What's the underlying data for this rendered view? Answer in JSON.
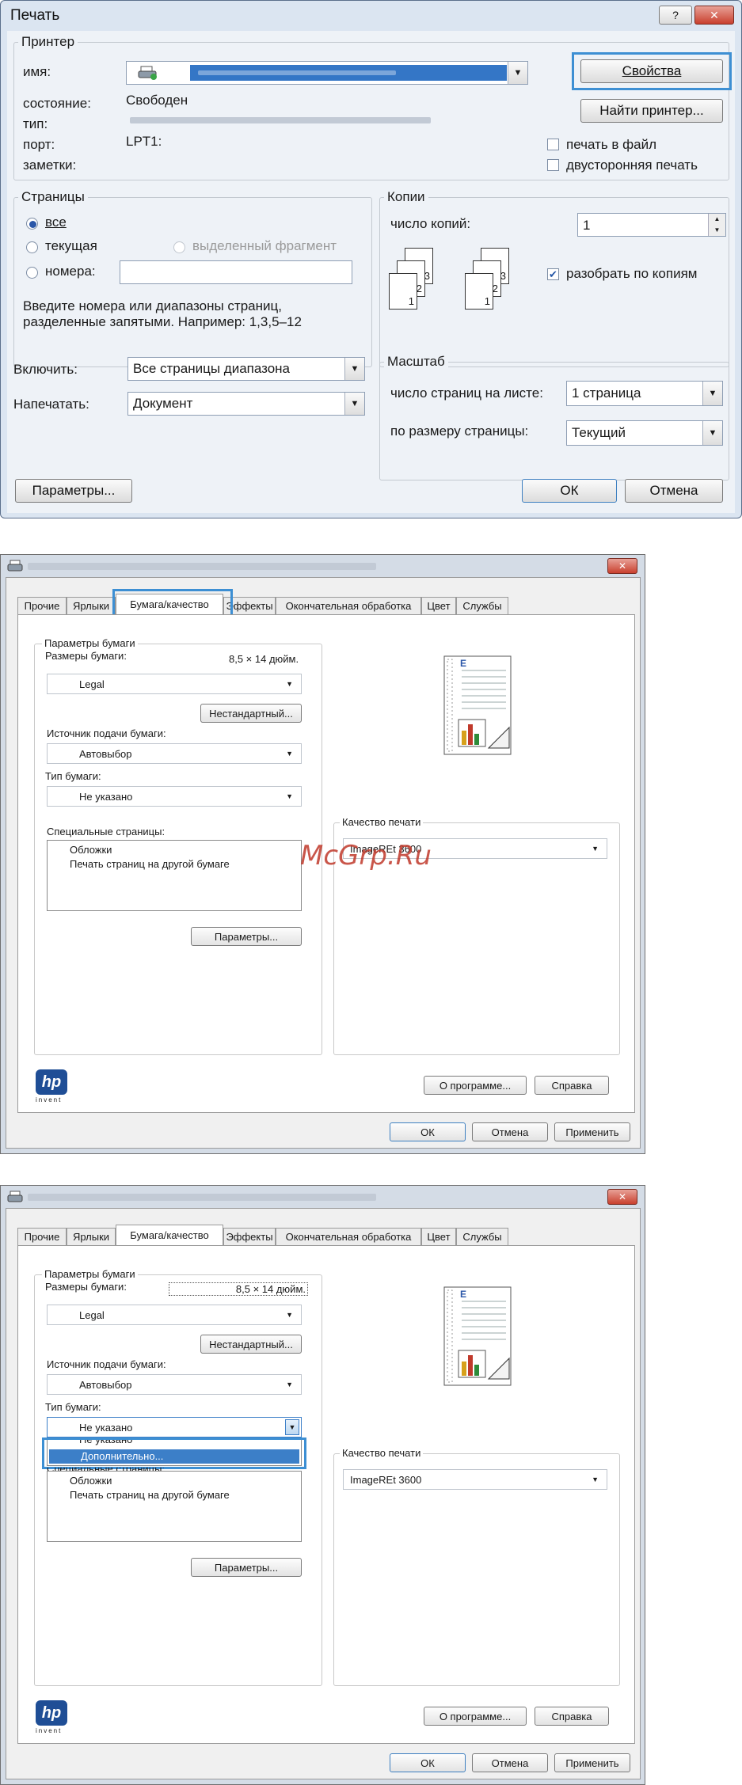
{
  "print_dialog": {
    "title": "Печать",
    "help_btn": "?",
    "close_btn": "✕",
    "printer_group": "Принтер",
    "name_label": "имя:",
    "properties_btn": "Свойства",
    "status_label": "состояние:",
    "status_value": "Свободен",
    "find_printer_btn": "Найти принтер...",
    "type_label": "тип:",
    "port_label": "порт:",
    "port_value": "LPT1:",
    "notes_label": "заметки:",
    "print_to_file": "печать в файл",
    "duplex": "двусторонняя печать",
    "pages_group": "Страницы",
    "radio_all": "все",
    "radio_current": "текущая",
    "radio_selection": "выделенный фрагмент",
    "radio_pages": "номера:",
    "hint_line1": "Введите номера или диапазоны страниц,",
    "hint_line2": "разделенные запятыми. Например: 1,3,5–12",
    "copies_group": "Копии",
    "copies_label": "число копий:",
    "copies_value": "1",
    "collate": "разобрать по копиям",
    "include_label": "Включить:",
    "include_value": "Все страницы диапазона",
    "print_what_label": "Напечатать:",
    "print_what_value": "Документ",
    "zoom_group": "Масштаб",
    "pages_per_sheet_label": "число страниц на листе:",
    "pages_per_sheet_value": "1 страница",
    "scale_label": "по размеру страницы:",
    "scale_value": "Текущий",
    "options_btn": "Параметры...",
    "ok_btn": "ОК",
    "cancel_btn": "Отмена",
    "collate_stack": [
      "3",
      "2",
      "1"
    ]
  },
  "props1": {
    "close_btn": "✕",
    "tabs": [
      "Прочие",
      "Ярлыки",
      "Бумага/качество",
      "Эффекты",
      "Окончательная обработка",
      "Цвет",
      "Службы"
    ],
    "active_tab_label": "Бумага/качество",
    "paper_group": "Параметры бумаги",
    "paper_sizes_label": "Размеры бумаги:",
    "paper_size_dims": "8,5 × 14 дюйм.",
    "paper_size_value": "Legal",
    "custom_btn": "Нестандартный...",
    "source_label": "Источник подачи бумаги:",
    "source_value": "Автовыбор",
    "type_label": "Тип бумаги:",
    "type_value": "Не указано",
    "special_label": "Специальные страницы:",
    "special_items": [
      "Обложки",
      "Печать страниц на другой бумаге"
    ],
    "params_btn": "Параметры...",
    "quality_group": "Качество печати",
    "quality_value": "ImageREt 3600",
    "watermark": "McGrp.Ru",
    "about_btn": "О программе...",
    "help_btn": "Справка",
    "ok_btn": "ОК",
    "cancel_btn": "Отмена",
    "apply_btn": "Применить",
    "hp_logo": "hp",
    "hp_invent": "invent",
    "preview_letter": "E"
  },
  "props2": {
    "close_btn": "✕",
    "tabs": [
      "Прочие",
      "Ярлыки",
      "Бумага/качество",
      "Эффекты",
      "Окончательная обработка",
      "Цвет",
      "Службы"
    ],
    "paper_group": "Параметры бумаги",
    "paper_sizes_label": "Размеры бумаги:",
    "paper_size_dims": "8,5 × 14 дюйм.",
    "paper_size_value": "Legal",
    "custom_btn": "Нестандартный...",
    "source_label": "Источник подачи бумаги:",
    "source_value": "Автовыбор",
    "type_label": "Тип бумаги:",
    "type_value": "Не указано",
    "dropdown_partial": "Не указано",
    "dropdown_item": "Дополнительно...",
    "special_label": "Специальные страницы:",
    "special_items": [
      "Обложки",
      "Печать страниц на другой бумаге"
    ],
    "params_btn": "Параметры...",
    "quality_group": "Качество печати",
    "quality_value": "ImageREt 3600",
    "about_btn": "О программе...",
    "help_btn": "Справка",
    "ok_btn": "ОК",
    "cancel_btn": "Отмена",
    "apply_btn": "Применить",
    "hp_logo": "hp",
    "hp_invent": "invent",
    "preview_letter": "E"
  },
  "colors": {
    "highlight": "#3d8fd3",
    "selection": "#3c7fc8",
    "watermark": "#c0392b"
  }
}
